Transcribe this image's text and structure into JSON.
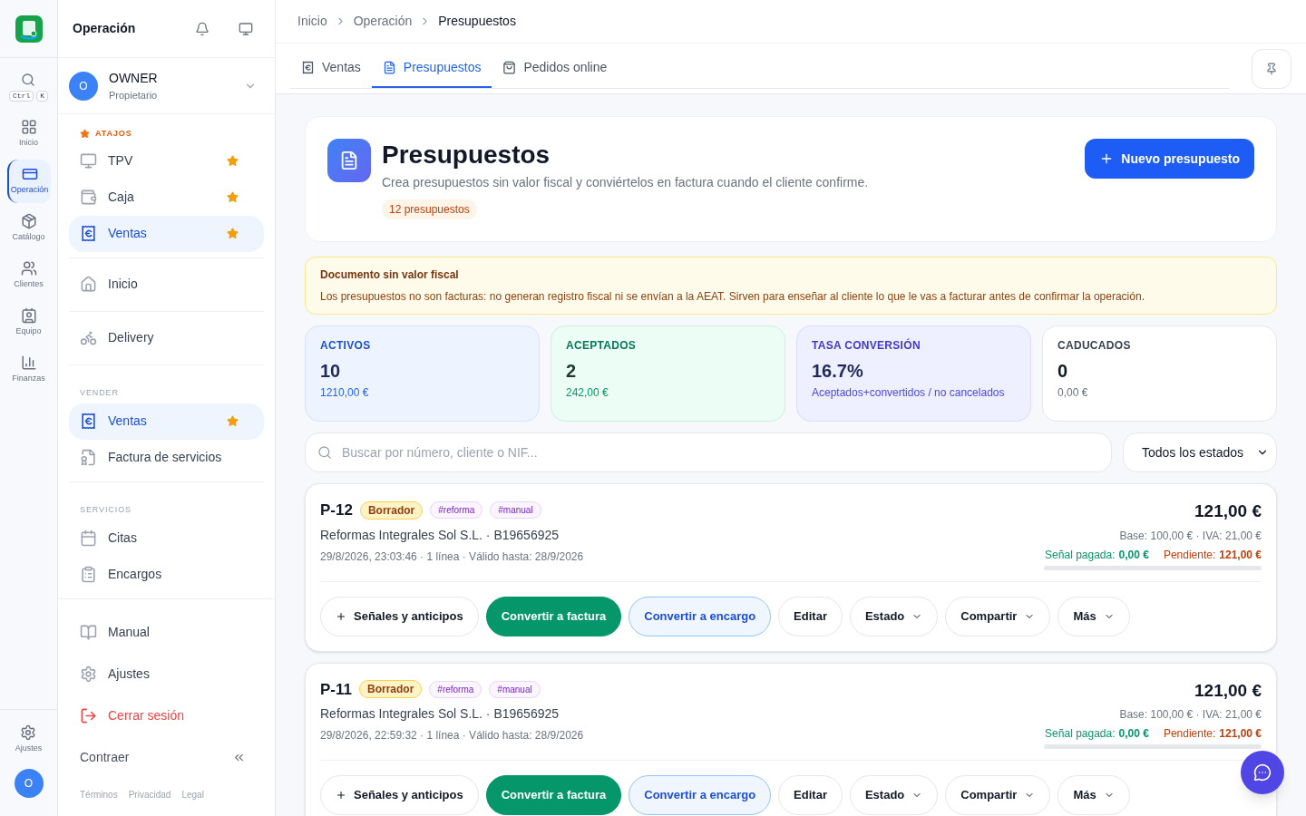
{
  "rail": {
    "search": {
      "keys": [
        "Ctrl",
        "K"
      ]
    },
    "items": [
      {
        "label": "Inicio",
        "selected": false
      },
      {
        "label": "Operación",
        "selected": true
      },
      {
        "label": "Catálogo",
        "selected": false
      },
      {
        "label": "Clientes",
        "selected": false
      },
      {
        "label": "Equipo",
        "selected": false
      },
      {
        "label": "Finanzas",
        "selected": false
      }
    ],
    "bottom": {
      "label": "Ajustes"
    },
    "avatar": "O"
  },
  "sidebar": {
    "title": "Operación",
    "user": {
      "avatar": "O",
      "name": "OWNER",
      "role": "Propietario"
    },
    "groups": [
      {
        "title": "ATAJOS",
        "kind": "shortcuts",
        "items": [
          {
            "label": "TPV",
            "starred": true,
            "selected": false
          },
          {
            "label": "Caja",
            "starred": true,
            "selected": false
          },
          {
            "label": "Ventas",
            "starred": true,
            "selected": true
          }
        ]
      },
      {
        "items": [
          {
            "label": "Inicio",
            "starred": false,
            "selected": false
          }
        ]
      },
      {
        "items": [
          {
            "label": "Delivery",
            "starred": false,
            "selected": false
          }
        ]
      },
      {
        "title": "VENDER",
        "kind": "section",
        "items": [
          {
            "label": "Ventas",
            "starred": true,
            "selected": true
          },
          {
            "label": "Factura de servicios",
            "starred": false,
            "selected": false
          }
        ]
      },
      {
        "title": "SERVICIOS",
        "kind": "section",
        "items": [
          {
            "label": "Citas",
            "starred": false,
            "selected": false
          },
          {
            "label": "Encargos",
            "starred": false,
            "selected": false
          }
        ]
      }
    ],
    "footer_items": [
      {
        "label": "Manual",
        "kind": "normal"
      },
      {
        "label": "Ajustes",
        "kind": "normal"
      },
      {
        "label": "Cerrar sesión",
        "kind": "danger"
      }
    ],
    "collapse": "Contraer",
    "links": [
      "Términos",
      "Privacidad",
      "Legal"
    ]
  },
  "breadcrumb": [
    "Inicio",
    "Operación",
    "Presupuestos"
  ],
  "tabs": [
    {
      "label": "Ventas",
      "selected": false
    },
    {
      "label": "Presupuestos",
      "selected": true
    },
    {
      "label": "Pedidos online",
      "selected": false
    }
  ],
  "header": {
    "title": "Presupuestos",
    "subtitle": "Crea presupuestos sin valor fiscal y conviértelos en factura cuando el cliente confirme.",
    "count": "12 presupuestos",
    "button": "Nuevo presupuesto"
  },
  "notice": {
    "title": "Documento sin valor fiscal",
    "text": "Los presupuestos no son facturas: no generan registro fiscal ni se envían a la AEAT. Sirven para enseñar al cliente lo que le vas a facturar antes de confirmar la operación."
  },
  "stats": [
    {
      "kind": "info",
      "label": "ACTIVOS",
      "value": "10",
      "detail": "1210,00 €"
    },
    {
      "kind": "success",
      "label": "ACEPTADOS",
      "value": "2",
      "detail": "242,00 €"
    },
    {
      "kind": "accent",
      "label": "TASA CONVERSIÓN",
      "value": "16.7%",
      "detail": "Aceptados+convertidos / no cancelados"
    },
    {
      "kind": "neutral",
      "label": "CADUCADOS",
      "value": "0",
      "detail": "0,00 €"
    }
  ],
  "search": {
    "placeholder": "Buscar por número, cliente o NIF..."
  },
  "filter": {
    "value": "Todos los estados"
  },
  "quotes": [
    {
      "number": "P-12",
      "status": "Borrador",
      "tags": [
        "#reforma",
        "#manual"
      ],
      "client": "Reformas Integrales Sol S.L. · B19656925",
      "meta": "29/8/2026, 23:03:46 · 1 línea · Válido hasta: 28/9/2026",
      "total": "121,00 €",
      "breakdown": "Base: 100,00 € · IVA: 21,00 €",
      "paid_label": "Señal pagada:",
      "paid": "0,00 €",
      "pending_label": "Pendiente:",
      "pending": "121,00 €",
      "level": 0,
      "actions": [
        {
          "label": "Señales y anticipos",
          "kind": "add"
        },
        {
          "label": "Convertir a factura",
          "kind": "primary"
        },
        {
          "label": "Convertir a encargo",
          "kind": "secondary"
        },
        {
          "label": "Editar",
          "kind": "plain"
        },
        {
          "label": "Estado",
          "kind": "menu"
        },
        {
          "label": "Compartir",
          "kind": "menu"
        },
        {
          "label": "Más",
          "kind": "menu"
        }
      ]
    },
    {
      "number": "P-11",
      "status": "Borrador",
      "tags": [
        "#reforma",
        "#manual"
      ],
      "client": "Reformas Integrales Sol S.L. · B19656925",
      "meta": "29/8/2026, 22:59:32 · 1 línea · Válido hasta: 28/9/2026",
      "total": "121,00 €",
      "breakdown": "Base: 100,00 € · IVA: 21,00 €",
      "paid_label": "Señal pagada:",
      "paid": "0,00 €",
      "pending_label": "Pendiente:",
      "pending": "121,00 €",
      "level": 0,
      "actions": [
        {
          "label": "Señales y anticipos",
          "kind": "add"
        },
        {
          "label": "Convertir a factura",
          "kind": "primary"
        },
        {
          "label": "Convertir a encargo",
          "kind": "secondary"
        },
        {
          "label": "Editar",
          "kind": "plain"
        },
        {
          "label": "Estado",
          "kind": "menu"
        },
        {
          "label": "Compartir",
          "kind": "menu"
        },
        {
          "label": "Más",
          "kind": "menu"
        }
      ]
    }
  ]
}
